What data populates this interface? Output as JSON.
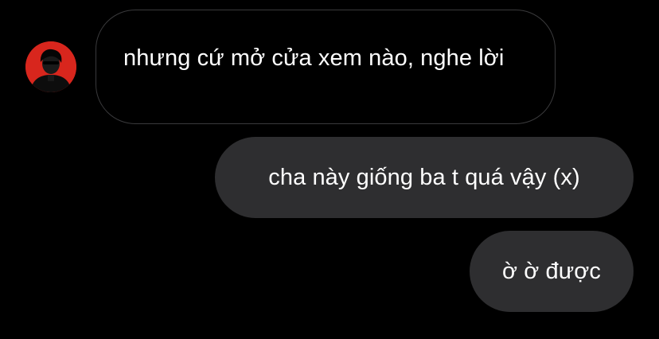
{
  "thread": {
    "contact": {
      "avatar_icon": "user-avatar-icon",
      "avatar_bg": "#d8261d"
    },
    "messages": [
      {
        "direction": "incoming",
        "text": "nhưng cứ mở cửa xem nào, nghe lời"
      },
      {
        "direction": "outgoing",
        "text": "cha này giống ba t quá vậy (x)"
      },
      {
        "direction": "outgoing",
        "text": "ờ ờ được"
      }
    ]
  },
  "colors": {
    "background": "#000000",
    "incoming_border": "#3a3a3c",
    "outgoing_bubble": "#2e2e30",
    "text": "#ffffff"
  }
}
